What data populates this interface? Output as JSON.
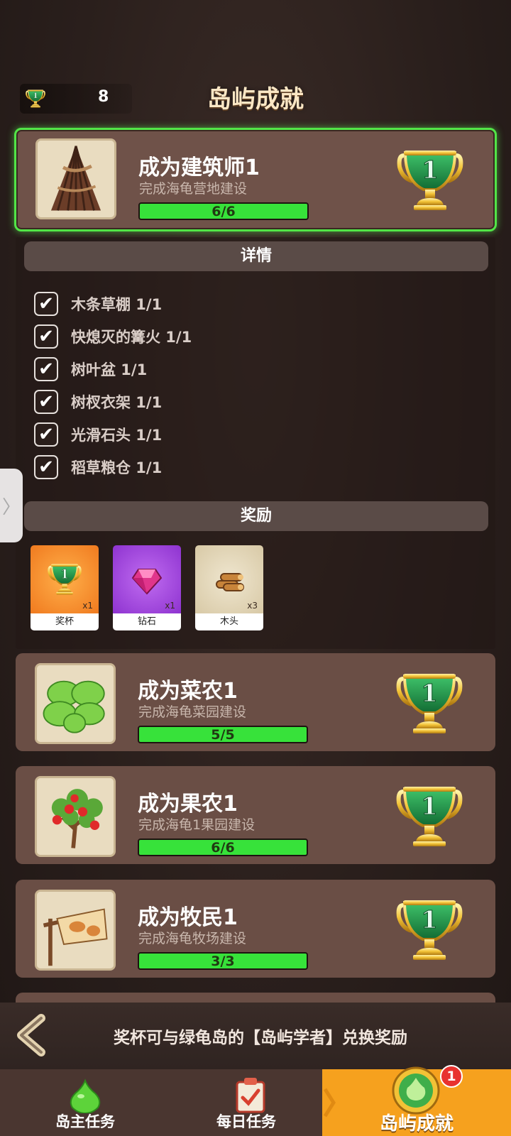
{
  "header": {
    "trophy_count": "8",
    "title": "岛屿成就"
  },
  "achievements": [
    {
      "name": "成为建筑师1",
      "desc": "完成海龟营地建设",
      "progress_text": "6/6",
      "progress": 1.0,
      "level": "1"
    },
    {
      "name": "成为菜农1",
      "desc": "完成海龟菜园建设",
      "progress_text": "5/5",
      "progress": 1.0,
      "level": "1"
    },
    {
      "name": "成为果农1",
      "desc": "完成海龟1果园建设",
      "progress_text": "6/6",
      "progress": 1.0,
      "level": "1"
    },
    {
      "name": "成为牧民1",
      "desc": "完成海龟牧场建设",
      "progress_text": "3/3",
      "progress": 1.0,
      "level": "1"
    }
  ],
  "details": {
    "header": "详情",
    "tasks": [
      {
        "label": "木条草棚 1/1",
        "done": true
      },
      {
        "label": "快熄灭的篝火 1/1",
        "done": true
      },
      {
        "label": "树叶盆 1/1",
        "done": true
      },
      {
        "label": "树杈衣架 1/1",
        "done": true
      },
      {
        "label": "光滑石头 1/1",
        "done": true
      },
      {
        "label": "稻草粮仓 1/1",
        "done": true
      }
    ],
    "check_glyph": "✔"
  },
  "rewards": {
    "header": "奖励",
    "items": [
      {
        "name": "奖杯",
        "qty": "x1",
        "color": "#f58a2b",
        "icon": "trophy-icon"
      },
      {
        "name": "钻石",
        "qty": "x1",
        "color": "#a748e0",
        "icon": "diamond-icon"
      },
      {
        "name": "木头",
        "qty": "x3",
        "color": "#e4d7b8",
        "icon": "wood-logs-icon"
      }
    ]
  },
  "side_tab": {
    "glyph": "〉"
  },
  "info_bar": {
    "text": "奖杯可与绿龟岛的【岛屿学者】兑换奖励"
  },
  "nav": {
    "items": [
      {
        "label": "岛主任务",
        "icon": "green-slime-icon"
      },
      {
        "label": "每日任务",
        "icon": "clipboard-check-icon"
      },
      {
        "label": "岛屿成就",
        "icon": "achievement-badge-icon",
        "badge": "1",
        "selected": true
      }
    ]
  },
  "colors": {
    "progress_fill": "#37e23a",
    "active_border": "#52e547",
    "trophy_gold": "#f2c236",
    "trophy_green": "#1f8a43",
    "nav_selected": "#f6a11e"
  }
}
